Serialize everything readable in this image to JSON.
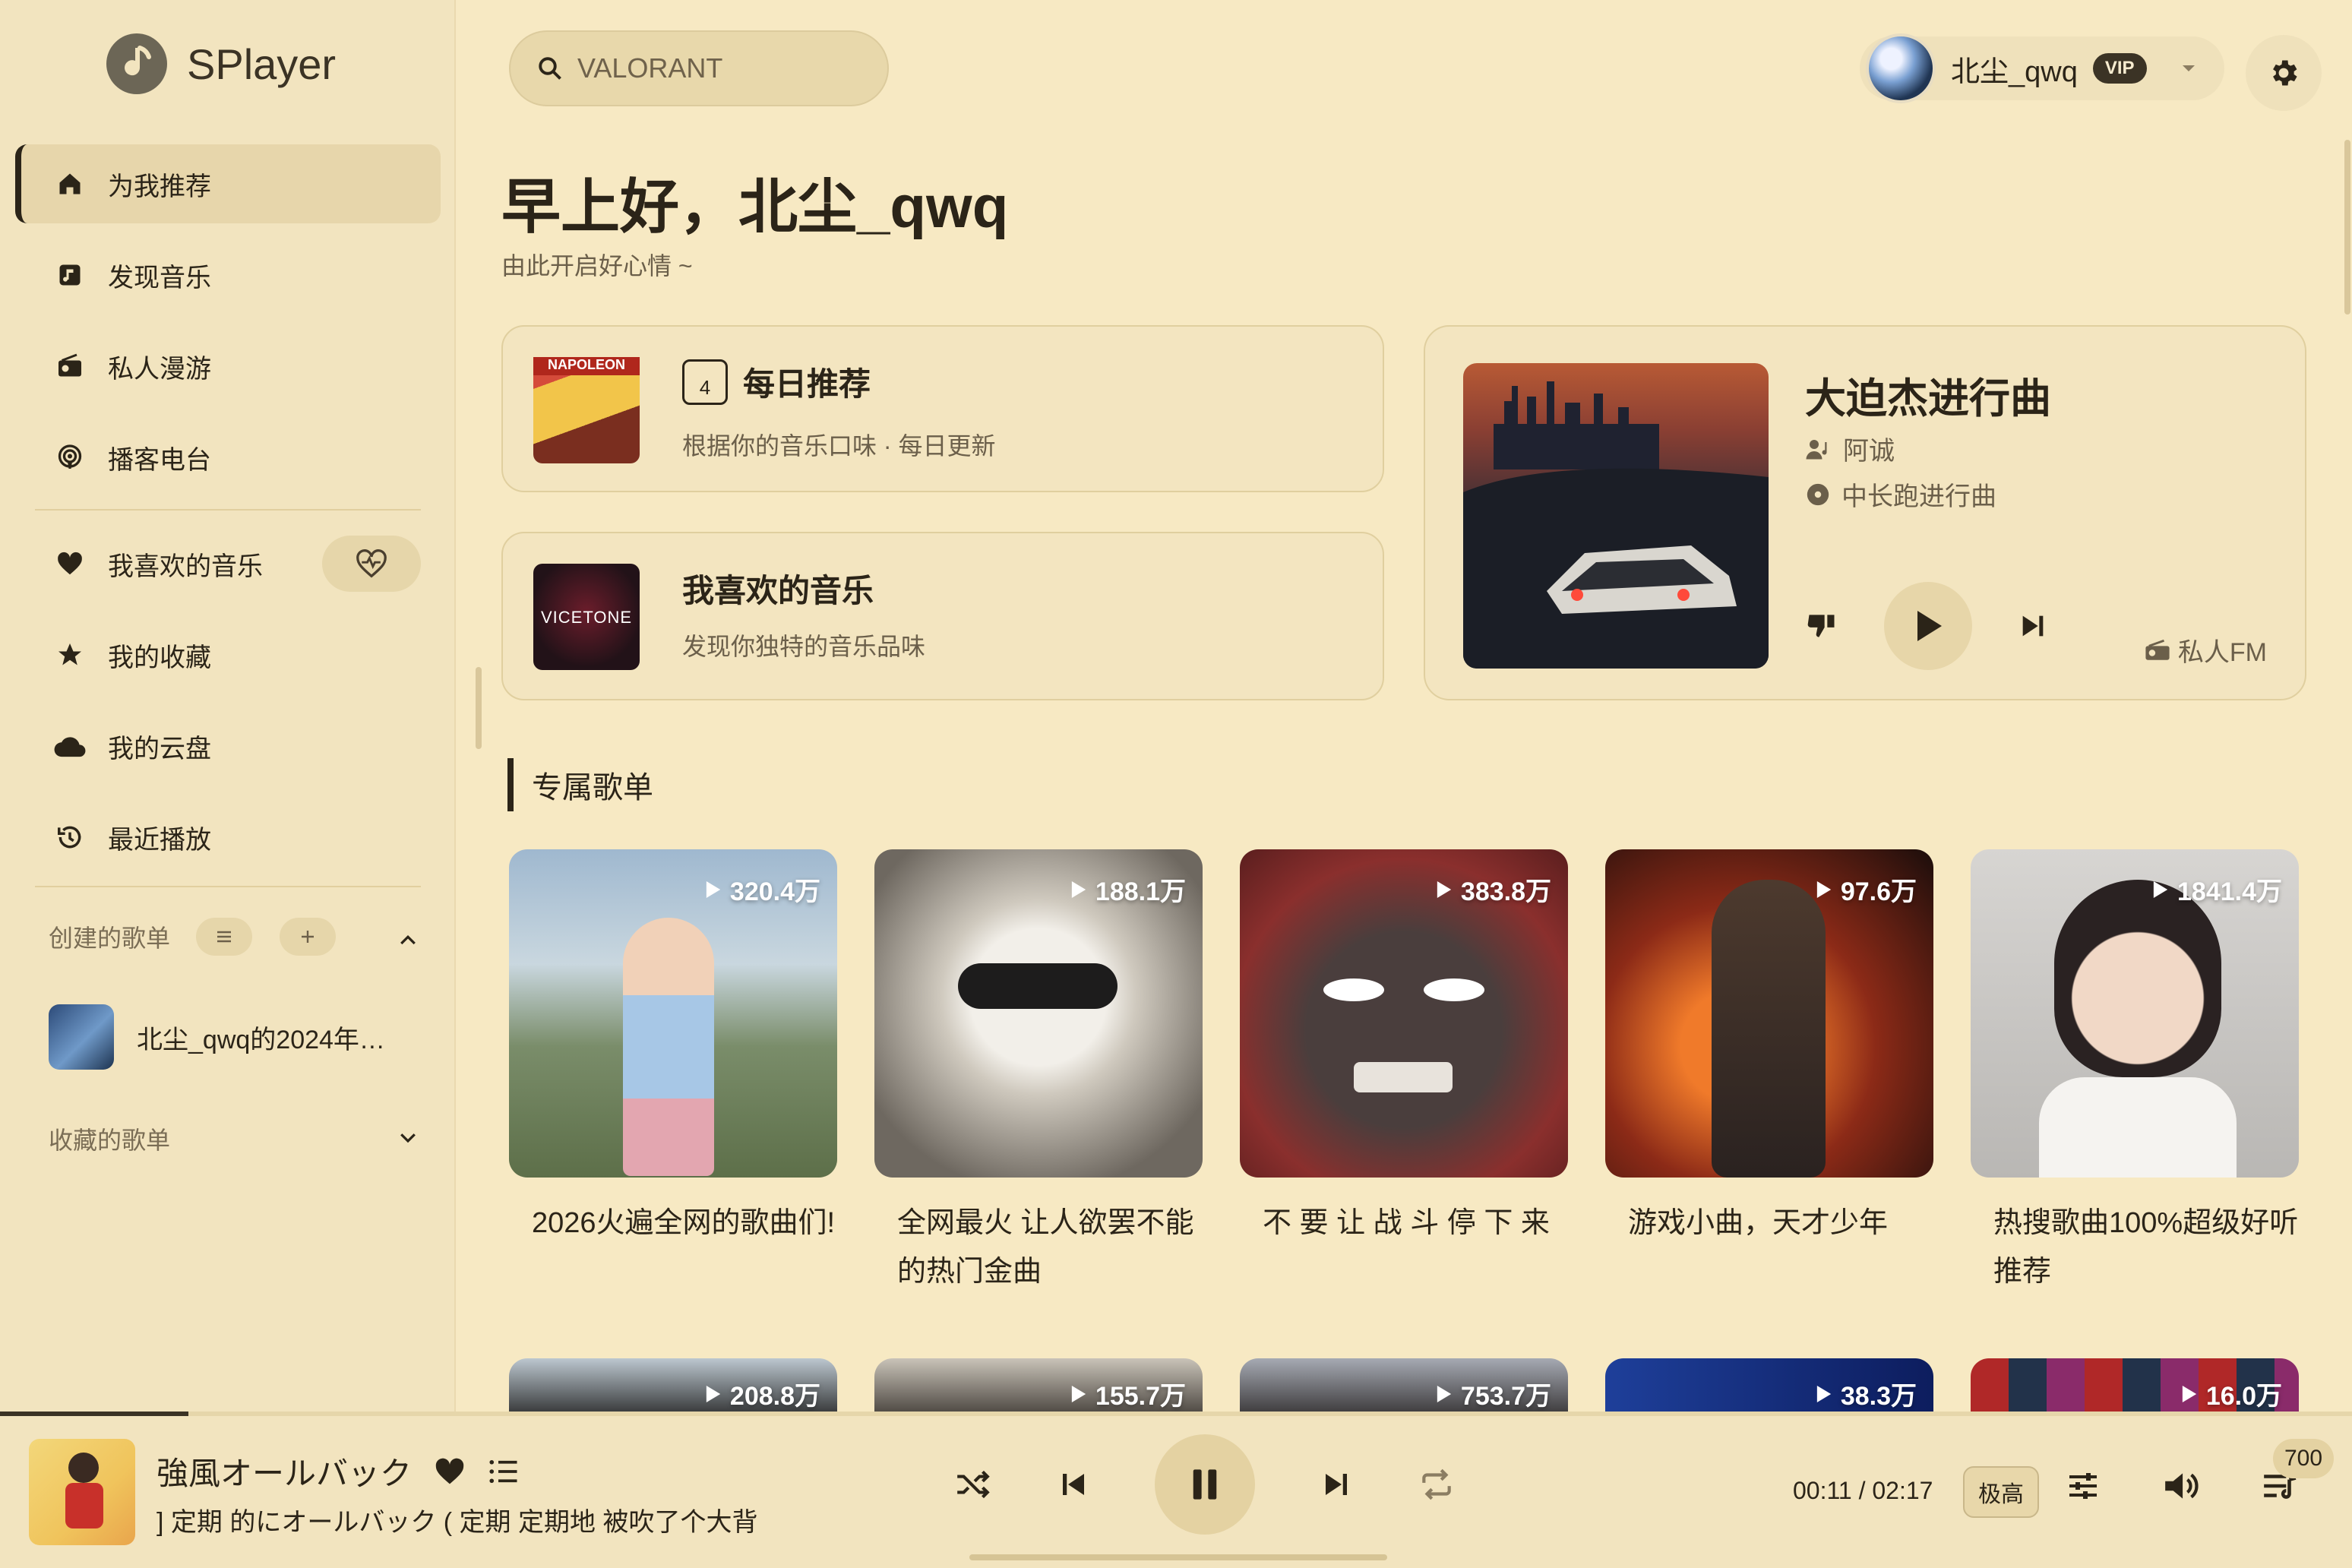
{
  "app": {
    "name": "SPlayer"
  },
  "search": {
    "placeholder": "VALORANT"
  },
  "user": {
    "name": "北尘_qwq",
    "vip_label": "VIP"
  },
  "sidebar": {
    "items": [
      {
        "label": "为我推荐"
      },
      {
        "label": "发现音乐"
      },
      {
        "label": "私人漫游"
      },
      {
        "label": "播客电台"
      },
      {
        "label": "我喜欢的音乐"
      },
      {
        "label": "我的收藏"
      },
      {
        "label": "我的云盘"
      },
      {
        "label": "最近播放"
      }
    ],
    "created_section": "创建的歌单",
    "created_playlist": "北尘_qwq的2024年…",
    "collected_section": "收藏的歌单"
  },
  "greeting": {
    "title": "早上好，北尘_qwq",
    "subtitle": "由此开启好心情 ~"
  },
  "daily": {
    "title": "每日推荐",
    "desc": "根据你的音乐口味 · 每日更新",
    "cal_day": "4",
    "cover_text": "NAPOLEON"
  },
  "liked": {
    "title": "我喜欢的音乐",
    "desc": "发现你独特的音乐品味",
    "cover_text": "VICETONE"
  },
  "fm": {
    "title": "大迫杰进行曲",
    "artist": "阿诚",
    "album": "中长跑进行曲",
    "label": "私人FM"
  },
  "section": {
    "title": "专属歌单"
  },
  "playlists": [
    {
      "count": "320.4万",
      "title": "2026火遍全网的歌曲们!"
    },
    {
      "count": "188.1万",
      "title": "全网最火 让人欲罢不能的热门金曲"
    },
    {
      "count": "383.8万",
      "title": "不 要 让 战 斗 停 下 来"
    },
    {
      "count": "97.6万",
      "title": "游戏小曲，天才少年"
    },
    {
      "count": "1841.4万",
      "title": "热搜歌曲100%超级好听推荐"
    }
  ],
  "playlists_row2": [
    {
      "count": "208.8万"
    },
    {
      "count": "155.7万"
    },
    {
      "count": "753.7万"
    },
    {
      "count": "38.3万"
    },
    {
      "count": "16.0万"
    }
  ],
  "player": {
    "title": "強風オールバック",
    "lyric": "] 定期 的にオールバック ( 定期 定期地 被吹了个大背",
    "time": "00:11 / 02:17",
    "quality": "极高",
    "queue_count": "700",
    "progress": 0.08
  },
  "colors": {
    "background": "#f7e9c3",
    "sidebar": "#f2e4bf",
    "text": "#2b2418",
    "accent": "#e7d6a9"
  }
}
